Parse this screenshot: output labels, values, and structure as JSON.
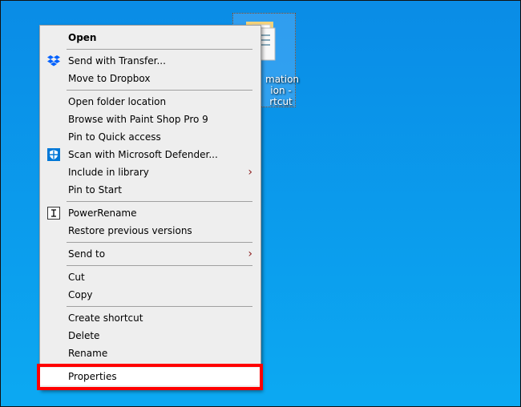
{
  "desktop_icon": {
    "label_lines": [
      "mation",
      "ion -",
      "rtcut"
    ]
  },
  "menu": {
    "groups": [
      [
        {
          "label": "Open",
          "bold": true
        }
      ],
      [
        {
          "label": "Send with Transfer...",
          "icon": "dropbox-icon"
        },
        {
          "label": "Move to Dropbox"
        }
      ],
      [
        {
          "label": "Open folder location"
        },
        {
          "label": "Browse with Paint Shop Pro 9"
        },
        {
          "label": "Pin to Quick access"
        },
        {
          "label": "Scan with Microsoft Defender...",
          "icon": "defender-shield-icon"
        },
        {
          "label": "Include in library",
          "submenu": true
        },
        {
          "label": "Pin to Start"
        }
      ],
      [
        {
          "label": "PowerRename",
          "icon": "powerrename-icon"
        },
        {
          "label": "Restore previous versions"
        }
      ],
      [
        {
          "label": "Send to",
          "submenu": true
        }
      ],
      [
        {
          "label": "Cut"
        },
        {
          "label": "Copy"
        }
      ],
      [
        {
          "label": "Create shortcut"
        },
        {
          "label": "Delete"
        },
        {
          "label": "Rename"
        }
      ],
      [
        {
          "label": "Properties",
          "highlighted": true
        }
      ]
    ]
  },
  "colors": {
    "highlight": "#ff0000",
    "accent": "#0a8ce6"
  }
}
